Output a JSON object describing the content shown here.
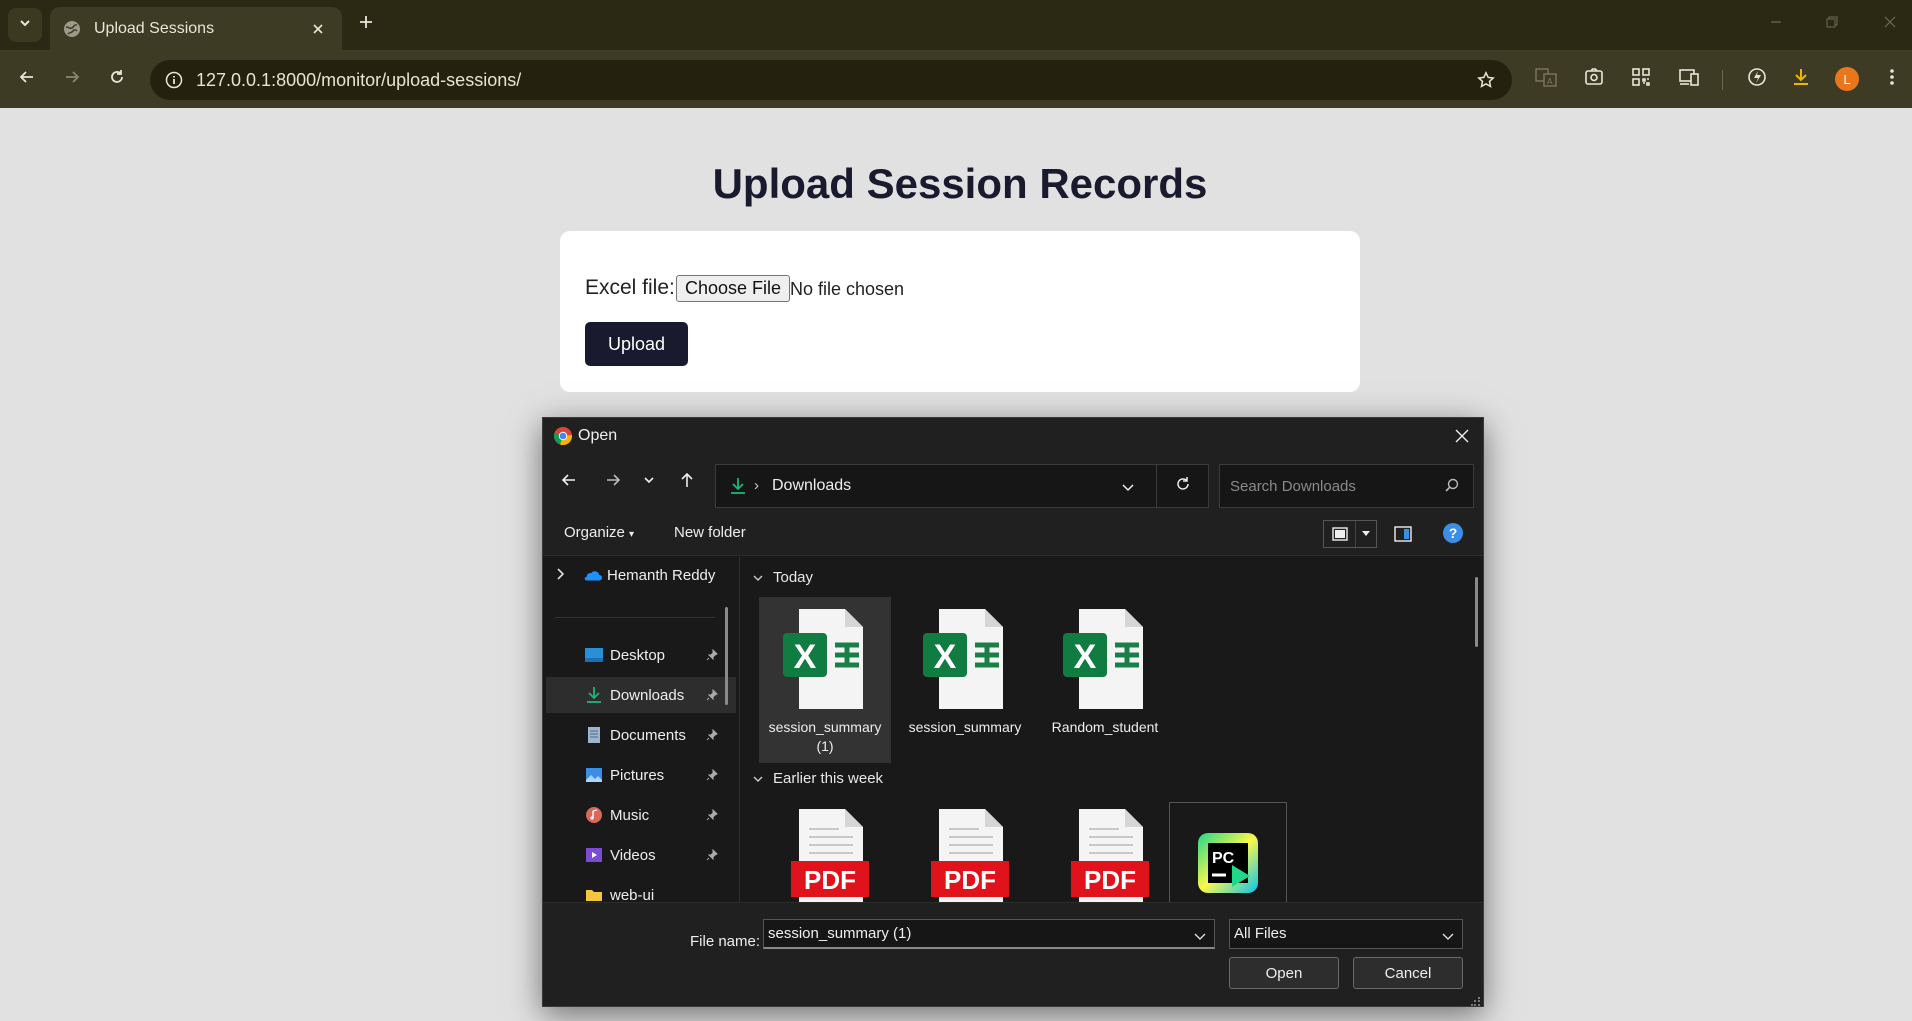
{
  "browser": {
    "tab_title": "Upload Sessions",
    "url": "127.0.0.1:8000/monitor/upload-sessions/",
    "profile_initial": "L",
    "colors": {
      "frame": "#2b2913",
      "toolbar": "#3d3b24",
      "profile": "#e8761c"
    }
  },
  "page": {
    "title": "Upload Session Records",
    "form": {
      "file_label": "Excel file:",
      "choose_button": "Choose File",
      "no_file_text": "No file chosen",
      "upload_button": "Upload"
    },
    "colors": {
      "primary": "#1a1a2e",
      "background": "#e1e1e1"
    }
  },
  "dialog": {
    "title": "Open",
    "breadcrumb": "Downloads",
    "search_placeholder": "Search Downloads",
    "toolbar": {
      "organize": "Organize",
      "new_folder": "New folder",
      "help": "?"
    },
    "nav": [
      {
        "label": "Hemanth Reddy",
        "icon": "onedrive-cloud-icon"
      },
      {
        "label": "Desktop",
        "icon": "desktop-folder-icon"
      },
      {
        "label": "Downloads",
        "icon": "download-folder-icon",
        "selected": true
      },
      {
        "label": "Documents",
        "icon": "documents-folder-icon"
      },
      {
        "label": "Pictures",
        "icon": "pictures-folder-icon"
      },
      {
        "label": "Music",
        "icon": "music-folder-icon"
      },
      {
        "label": "Videos",
        "icon": "videos-folder-icon"
      },
      {
        "label": "web-ui",
        "icon": "folder-icon"
      }
    ],
    "groups": [
      {
        "label": "Today",
        "files": [
          {
            "name": "session_summary (1)",
            "type": "excel",
            "selected": true
          },
          {
            "name": "session_summary",
            "type": "excel"
          },
          {
            "name": "Random_student",
            "type": "excel"
          }
        ]
      },
      {
        "label": "Earlier this week",
        "files": [
          {
            "name": "",
            "type": "pdf"
          },
          {
            "name": "",
            "type": "pdf"
          },
          {
            "name": "",
            "type": "pdf"
          },
          {
            "name": "",
            "type": "pycharm"
          }
        ]
      }
    ],
    "pdf_badge": "PDF",
    "pycharm_badge": "PC",
    "excel_badge": "X",
    "footer": {
      "file_name_label": "File name:",
      "file_name_value": "session_summary (1)",
      "file_type_value": "All Files",
      "open_button": "Open",
      "cancel_button": "Cancel"
    }
  }
}
